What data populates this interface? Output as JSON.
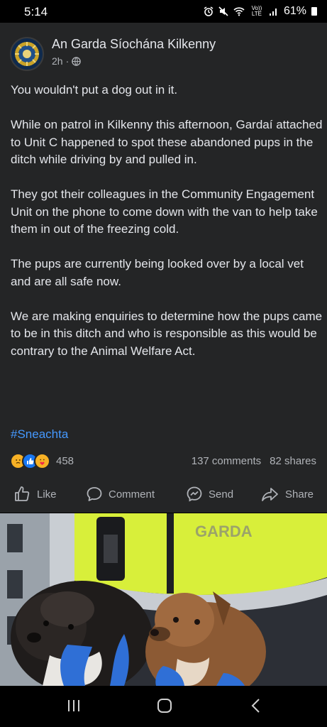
{
  "status_bar": {
    "time": "5:14",
    "network": "Vo)) LTE",
    "battery": "61%"
  },
  "post": {
    "page_name": "An Garda Síochána Kilkenny",
    "time_ago": "2h",
    "separator": "·",
    "audience_icon": "globe-icon",
    "paragraphs": [
      "You wouldn't put a dog out in it.",
      "While on patrol in Kilkenny this afternoon, Gardaí attached to Unit C happened to spot these abandoned pups in the ditch while driving by and pulled in.",
      "They got their colleagues in the Community Engagement Unit on the phone to come down with the van to help take them in out of the freezing cold.",
      "The pups are currently being looked over by a local vet and are all safe now.",
      "We are making enquiries to determine how the pups came to be in this ditch and who is responsible as this would be contrary to the Animal Welfare Act."
    ],
    "hashtag": "#Sneachta",
    "reactions": {
      "icons": [
        "sad-icon",
        "like-icon",
        "care-icon"
      ],
      "count": "458"
    },
    "comments": "137 comments",
    "shares": "82 shares"
  },
  "actions": {
    "like": "Like",
    "comment": "Comment",
    "send": "Send",
    "share": "Share"
  },
  "photo": {
    "vest_text": "GARDA"
  },
  "colors": {
    "background": "#242526",
    "text": "#e4e6eb",
    "muted": "#b0b3b8",
    "link": "#4599ff",
    "vest": "#d8ef3a"
  }
}
